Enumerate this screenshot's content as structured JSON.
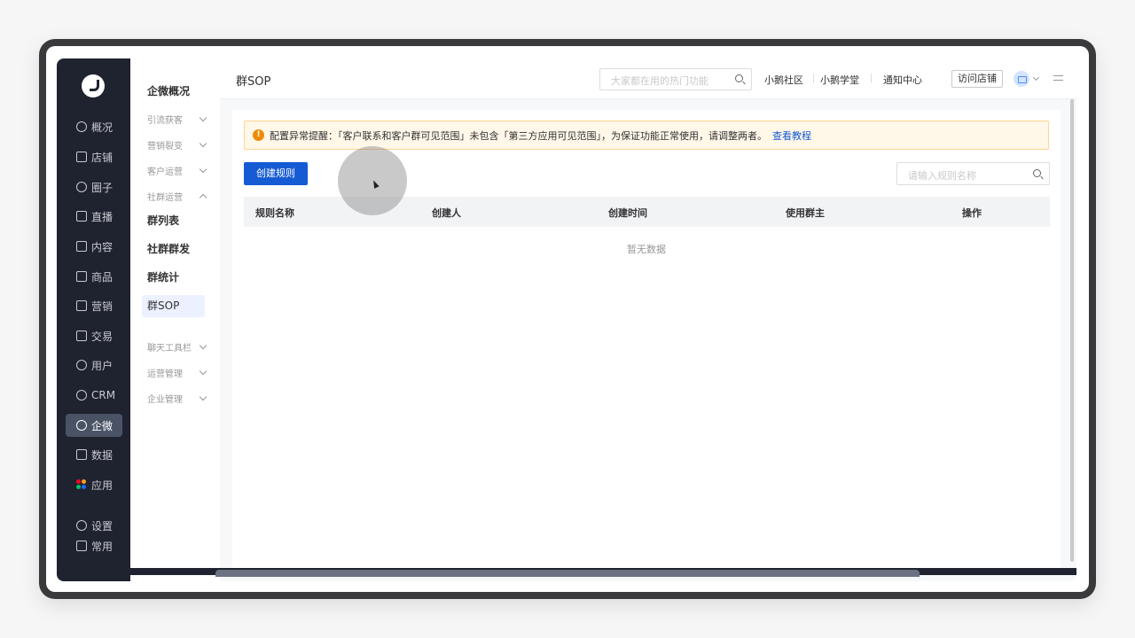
{
  "rail": {
    "items": [
      {
        "label": "概况",
        "icon": "pie-chart-icon"
      },
      {
        "label": "店铺",
        "icon": "store-icon"
      },
      {
        "label": "圈子",
        "icon": "group-icon"
      },
      {
        "label": "直播",
        "icon": "live-icon"
      },
      {
        "label": "内容",
        "icon": "document-icon"
      },
      {
        "label": "商品",
        "icon": "bag-icon"
      },
      {
        "label": "营销",
        "icon": "megaphone-icon"
      },
      {
        "label": "交易",
        "icon": "trade-icon"
      },
      {
        "label": "用户",
        "icon": "user-icon"
      },
      {
        "label": "CRM",
        "icon": "crm-icon"
      },
      {
        "label": "企微",
        "icon": "wecom-icon"
      },
      {
        "label": "数据",
        "icon": "data-icon"
      },
      {
        "label": "应用",
        "icon": "apps-icon"
      },
      {
        "label": "设置",
        "icon": "settings-icon"
      },
      {
        "label": "常用",
        "icon": "list-icon"
      }
    ],
    "active": "企微"
  },
  "subnav": {
    "title": "企微概况",
    "groups": [
      "引流获客",
      "营销裂变",
      "客户运营",
      "社群运营",
      "聊天工具栏",
      "运营管理",
      "企业管理"
    ],
    "links": [
      "群列表",
      "社群群发",
      "群统计",
      "群SOP"
    ],
    "active": "群SOP"
  },
  "topbar": {
    "title": "群SOP",
    "search_placeholder": "大家都在用的热门功能",
    "links": [
      "小鹅社区",
      "小鹅学堂",
      "通知中心"
    ],
    "visit_store": "访问店铺"
  },
  "alert": {
    "text": "配置异常提醒：「客户联系和客户群可见范围」未包含「第三方应用可见范围」，为保证功能正常使用，请调整两者。",
    "link": "查看教程"
  },
  "toolbar": {
    "create_label": "创建规则",
    "search_placeholder": "请输入规则名称"
  },
  "table": {
    "columns": [
      "规则名称",
      "创建人",
      "创建时间",
      "使用群主",
      "操作"
    ],
    "empty_text": "暂无数据"
  },
  "colors": {
    "primary": "#155bd4",
    "rail_bg": "#1f2330",
    "warning": "#ed8b07"
  }
}
